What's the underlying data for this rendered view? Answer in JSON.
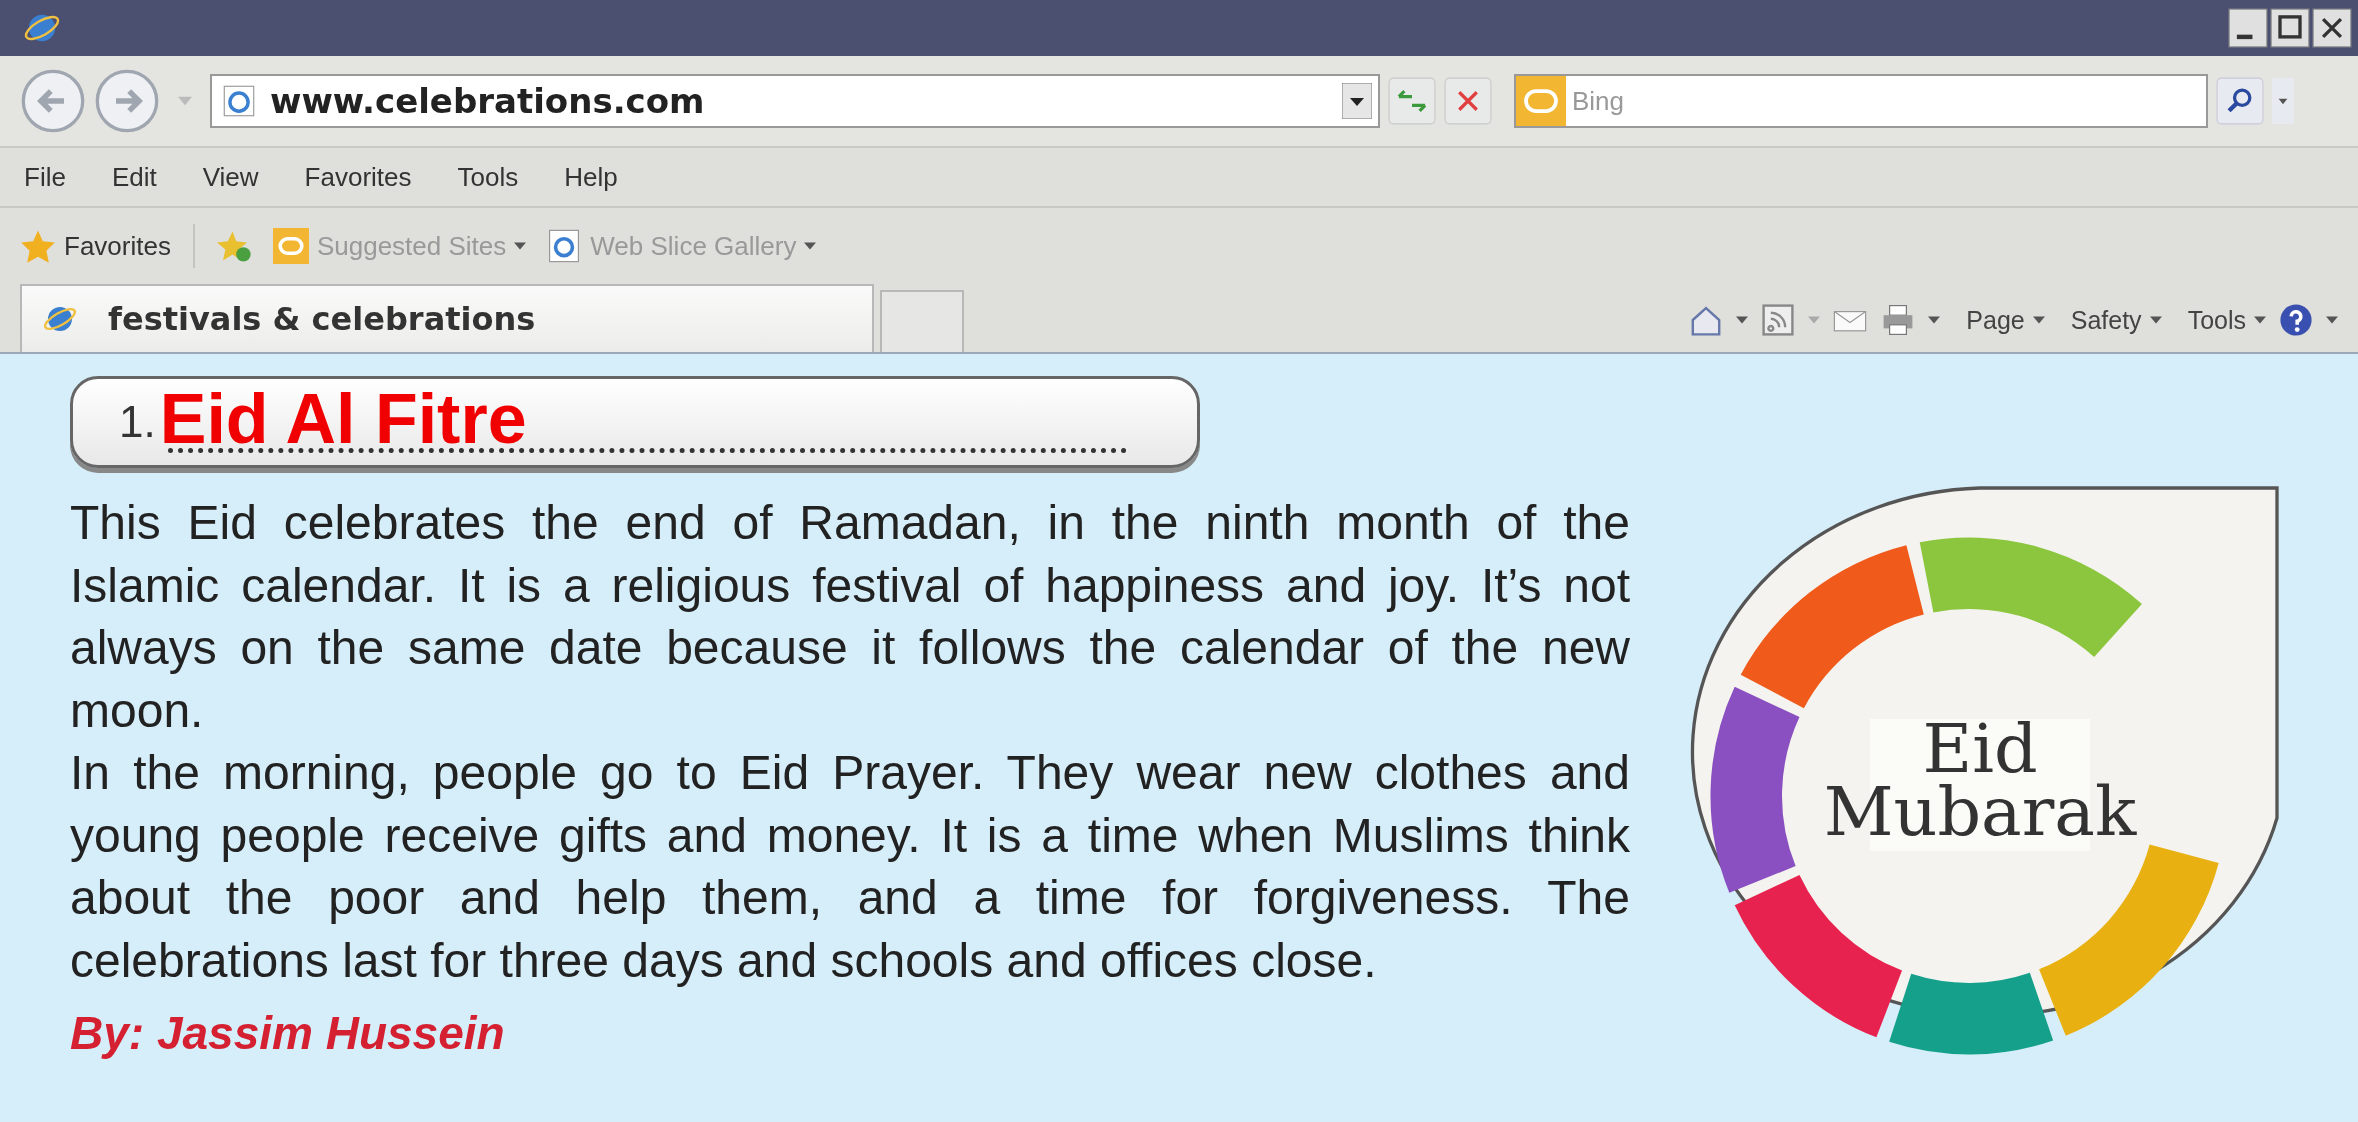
{
  "address_bar": {
    "value": "www.celebrations.com"
  },
  "search": {
    "placeholder": "Bing"
  },
  "menu": [
    "File",
    "Edit",
    "View",
    "Favorites",
    "Tools",
    "Help"
  ],
  "favorites_bar": {
    "favorites": "Favorites",
    "links": [
      "Suggested Sites",
      "Web Slice Gallery"
    ]
  },
  "tab": {
    "title": "festivals & celebrations"
  },
  "command_bar": [
    "Page",
    "Safety",
    "Tools"
  ],
  "article": {
    "number": "1.",
    "answer": "Eid Al Fitre",
    "paragraphs": [
      "This Eid celebrates the end of Ramadan, in the ninth month of the Islamic calendar. It is a religious festival of happiness and joy. It’s not always on the same date because it follows the calendar of the new moon.",
      "In the morning, people go to Eid Prayer. They wear new clothes and young people receive gifts and money. It is a time when Muslims think about the poor and help them, and a time for forgiveness. The celebrations last for three days and schools and offices close."
    ],
    "byline": "By: Jassim Hussein",
    "card": {
      "line1": "Eid",
      "line2": "Mubarak"
    }
  }
}
